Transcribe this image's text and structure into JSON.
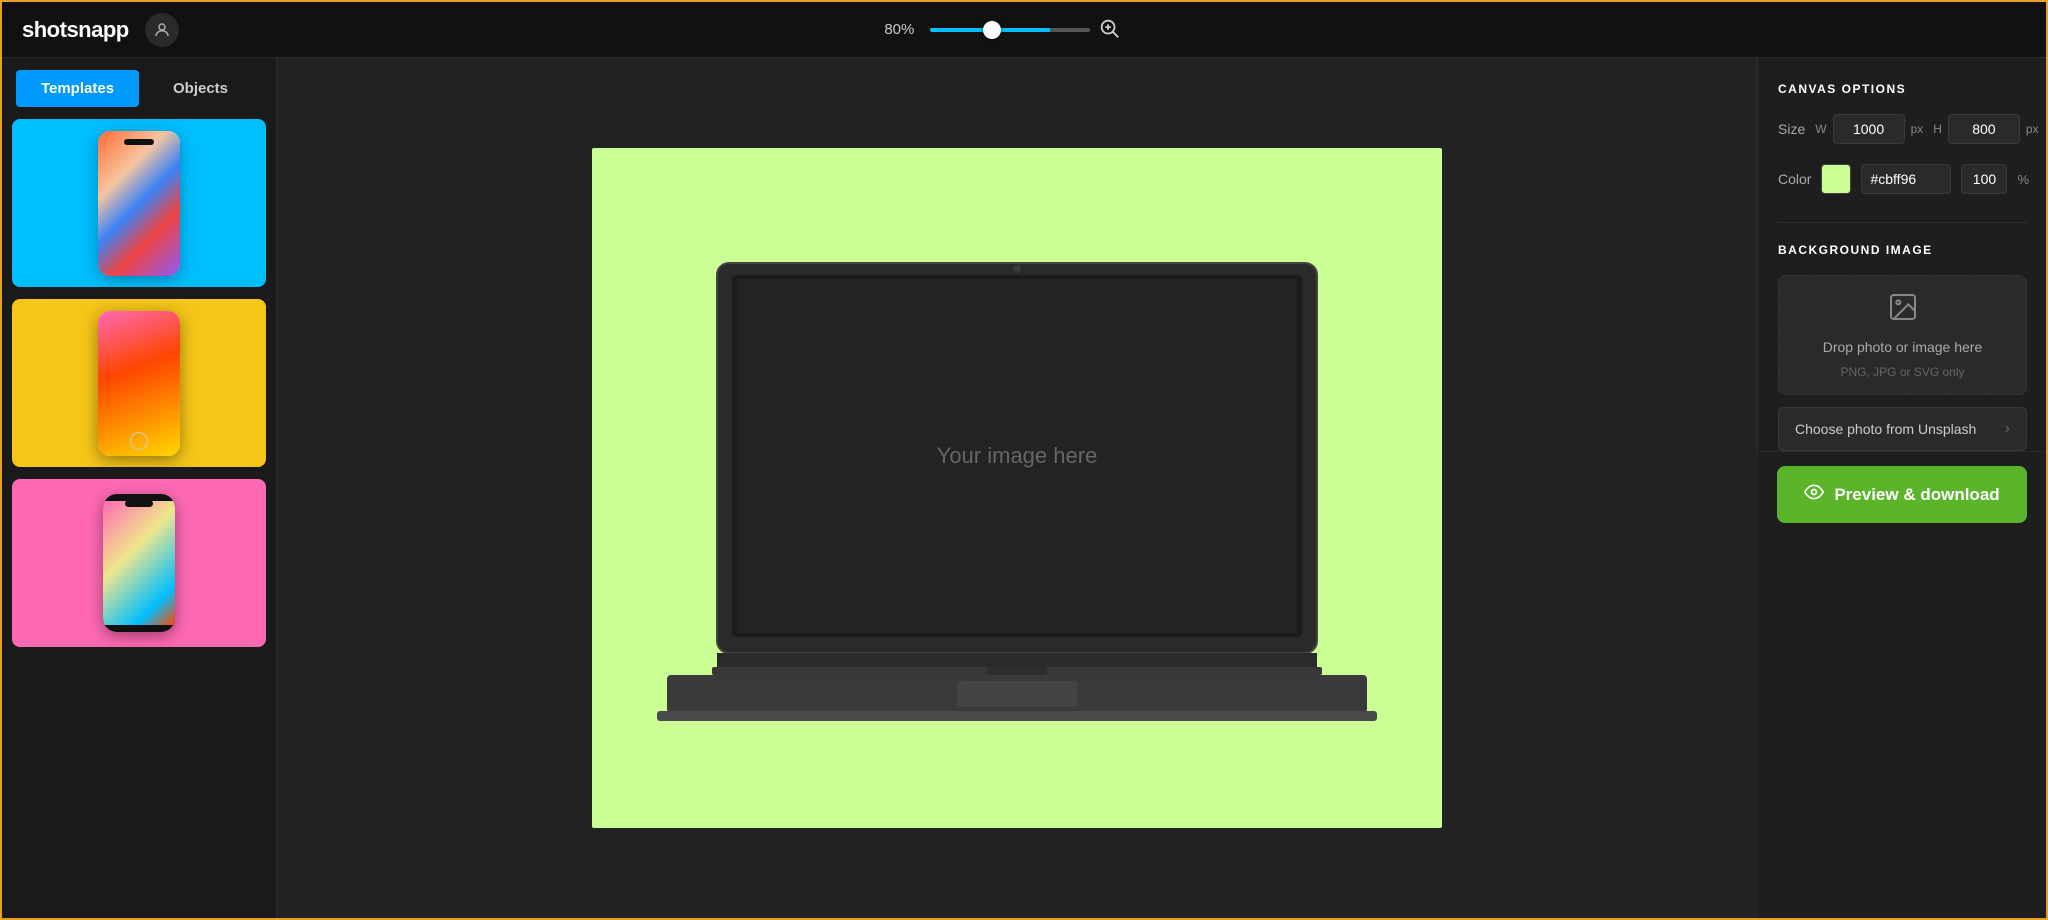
{
  "app": {
    "name": "shotsnapp",
    "user_icon": "👤"
  },
  "topbar": {
    "zoom_percent": "80%",
    "zoom_value": 80,
    "zoom_in_icon": "⊕"
  },
  "sidebar": {
    "tabs": [
      {
        "id": "templates",
        "label": "Templates",
        "active": true
      },
      {
        "id": "objects",
        "label": "Objects",
        "active": false
      }
    ],
    "templates": [
      {
        "id": 1,
        "bg": "#00bfff"
      },
      {
        "id": 2,
        "bg": "#f5c518"
      },
      {
        "id": 3,
        "bg": "#ff69b4"
      }
    ]
  },
  "canvas": {
    "bg_color": "#cbff96",
    "image_placeholder": "Your image here"
  },
  "right_panel": {
    "section_title": "CANVAS OPTIONS",
    "size": {
      "label": "Size",
      "width_label": "W",
      "width_value": "1000",
      "width_unit": "px",
      "height_label": "H",
      "height_value": "800",
      "height_unit": "px"
    },
    "color": {
      "label": "Color",
      "hex_value": "#cbff96",
      "opacity_value": "100",
      "opacity_unit": "%"
    },
    "bg_image": {
      "section_title": "BACKGROUND IMAGE",
      "drop_text": "Drop photo or image here",
      "drop_subtext": "PNG, JPG or SVG only",
      "unsplash_label": "Choose photo from Unsplash"
    },
    "preview_btn": "Preview & download"
  }
}
